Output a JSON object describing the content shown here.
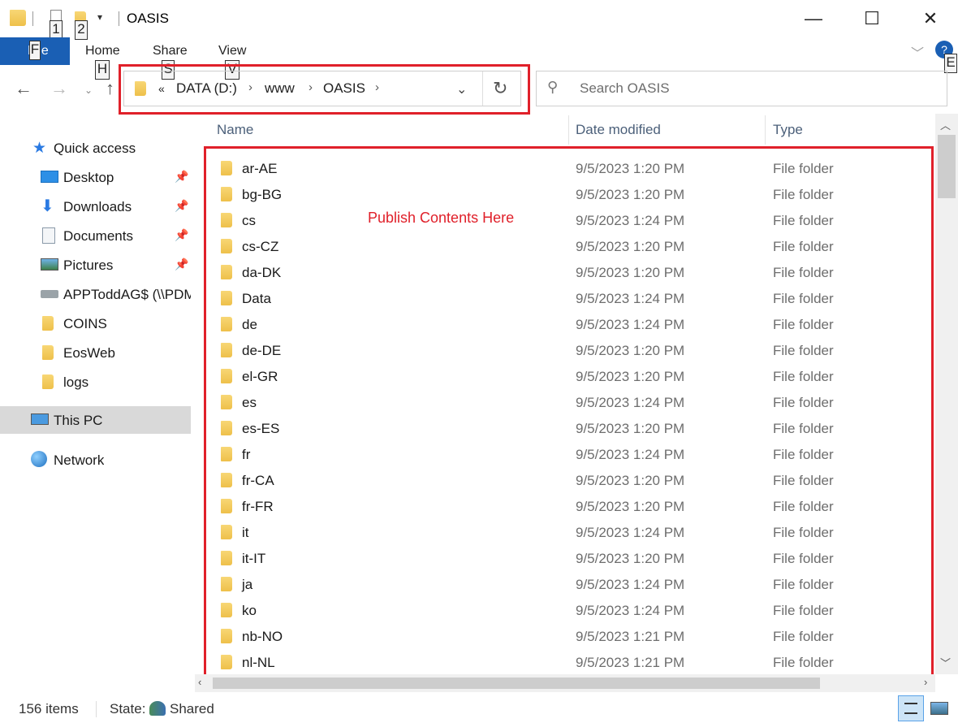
{
  "window": {
    "title": "OASIS",
    "keytips": {
      "quick1": "1",
      "quick2": "2",
      "file": "F",
      "home": "H",
      "share": "S",
      "view": "V",
      "expand": "E"
    },
    "controls": {
      "minimize": "—",
      "maximize": "☐",
      "close": "✕"
    }
  },
  "ribbon": {
    "tabs": {
      "file": "File",
      "home": "Home",
      "share": "Share",
      "view": "View"
    }
  },
  "address": {
    "overflow": "«",
    "crumbs": [
      "DATA (D:)",
      "www",
      "OASIS"
    ],
    "separator": "›"
  },
  "search": {
    "placeholder": "Search OASIS"
  },
  "navpane": {
    "quick_access": "Quick access",
    "items": [
      {
        "label": "Desktop",
        "icon": "desktop-icon",
        "pinned": true
      },
      {
        "label": "Downloads",
        "icon": "downloads-icon",
        "pinned": true
      },
      {
        "label": "Documents",
        "icon": "documents-icon",
        "pinned": true
      },
      {
        "label": "Pictures",
        "icon": "pictures-icon",
        "pinned": true
      },
      {
        "label": "APPToddAG$ (\\\\PDM",
        "icon": "network-drive-icon",
        "pinned": false
      },
      {
        "label": "COINS",
        "icon": "folder-icon",
        "pinned": false
      },
      {
        "label": "EosWeb",
        "icon": "folder-icon",
        "pinned": false
      },
      {
        "label": "logs",
        "icon": "folder-icon",
        "pinned": false
      }
    ],
    "this_pc": "This PC",
    "network": "Network"
  },
  "filelist": {
    "columns": {
      "name": "Name",
      "date": "Date modified",
      "type": "Type"
    },
    "annotation": "Publish Contents Here",
    "rows": [
      {
        "name": "ar-AE",
        "date": "9/5/2023 1:20 PM",
        "type": "File folder"
      },
      {
        "name": "bg-BG",
        "date": "9/5/2023 1:20 PM",
        "type": "File folder"
      },
      {
        "name": "cs",
        "date": "9/5/2023 1:24 PM",
        "type": "File folder"
      },
      {
        "name": "cs-CZ",
        "date": "9/5/2023 1:20 PM",
        "type": "File folder"
      },
      {
        "name": "da-DK",
        "date": "9/5/2023 1:20 PM",
        "type": "File folder"
      },
      {
        "name": "Data",
        "date": "9/5/2023 1:24 PM",
        "type": "File folder"
      },
      {
        "name": "de",
        "date": "9/5/2023 1:24 PM",
        "type": "File folder"
      },
      {
        "name": "de-DE",
        "date": "9/5/2023 1:20 PM",
        "type": "File folder"
      },
      {
        "name": "el-GR",
        "date": "9/5/2023 1:20 PM",
        "type": "File folder"
      },
      {
        "name": "es",
        "date": "9/5/2023 1:24 PM",
        "type": "File folder"
      },
      {
        "name": "es-ES",
        "date": "9/5/2023 1:20 PM",
        "type": "File folder"
      },
      {
        "name": "fr",
        "date": "9/5/2023 1:24 PM",
        "type": "File folder"
      },
      {
        "name": "fr-CA",
        "date": "9/5/2023 1:20 PM",
        "type": "File folder"
      },
      {
        "name": "fr-FR",
        "date": "9/5/2023 1:20 PM",
        "type": "File folder"
      },
      {
        "name": "it",
        "date": "9/5/2023 1:24 PM",
        "type": "File folder"
      },
      {
        "name": "it-IT",
        "date": "9/5/2023 1:20 PM",
        "type": "File folder"
      },
      {
        "name": "ja",
        "date": "9/5/2023 1:24 PM",
        "type": "File folder"
      },
      {
        "name": "ko",
        "date": "9/5/2023 1:24 PM",
        "type": "File folder"
      },
      {
        "name": "nb-NO",
        "date": "9/5/2023 1:21 PM",
        "type": "File folder"
      },
      {
        "name": "nl-NL",
        "date": "9/5/2023 1:21 PM",
        "type": "File folder"
      }
    ]
  },
  "status": {
    "count": "156 items",
    "state_label": "State:",
    "state_value": "Shared"
  },
  "colors": {
    "accent": "#1a5fb4",
    "highlight": "#e0202a",
    "folder": "#f0c44e"
  }
}
